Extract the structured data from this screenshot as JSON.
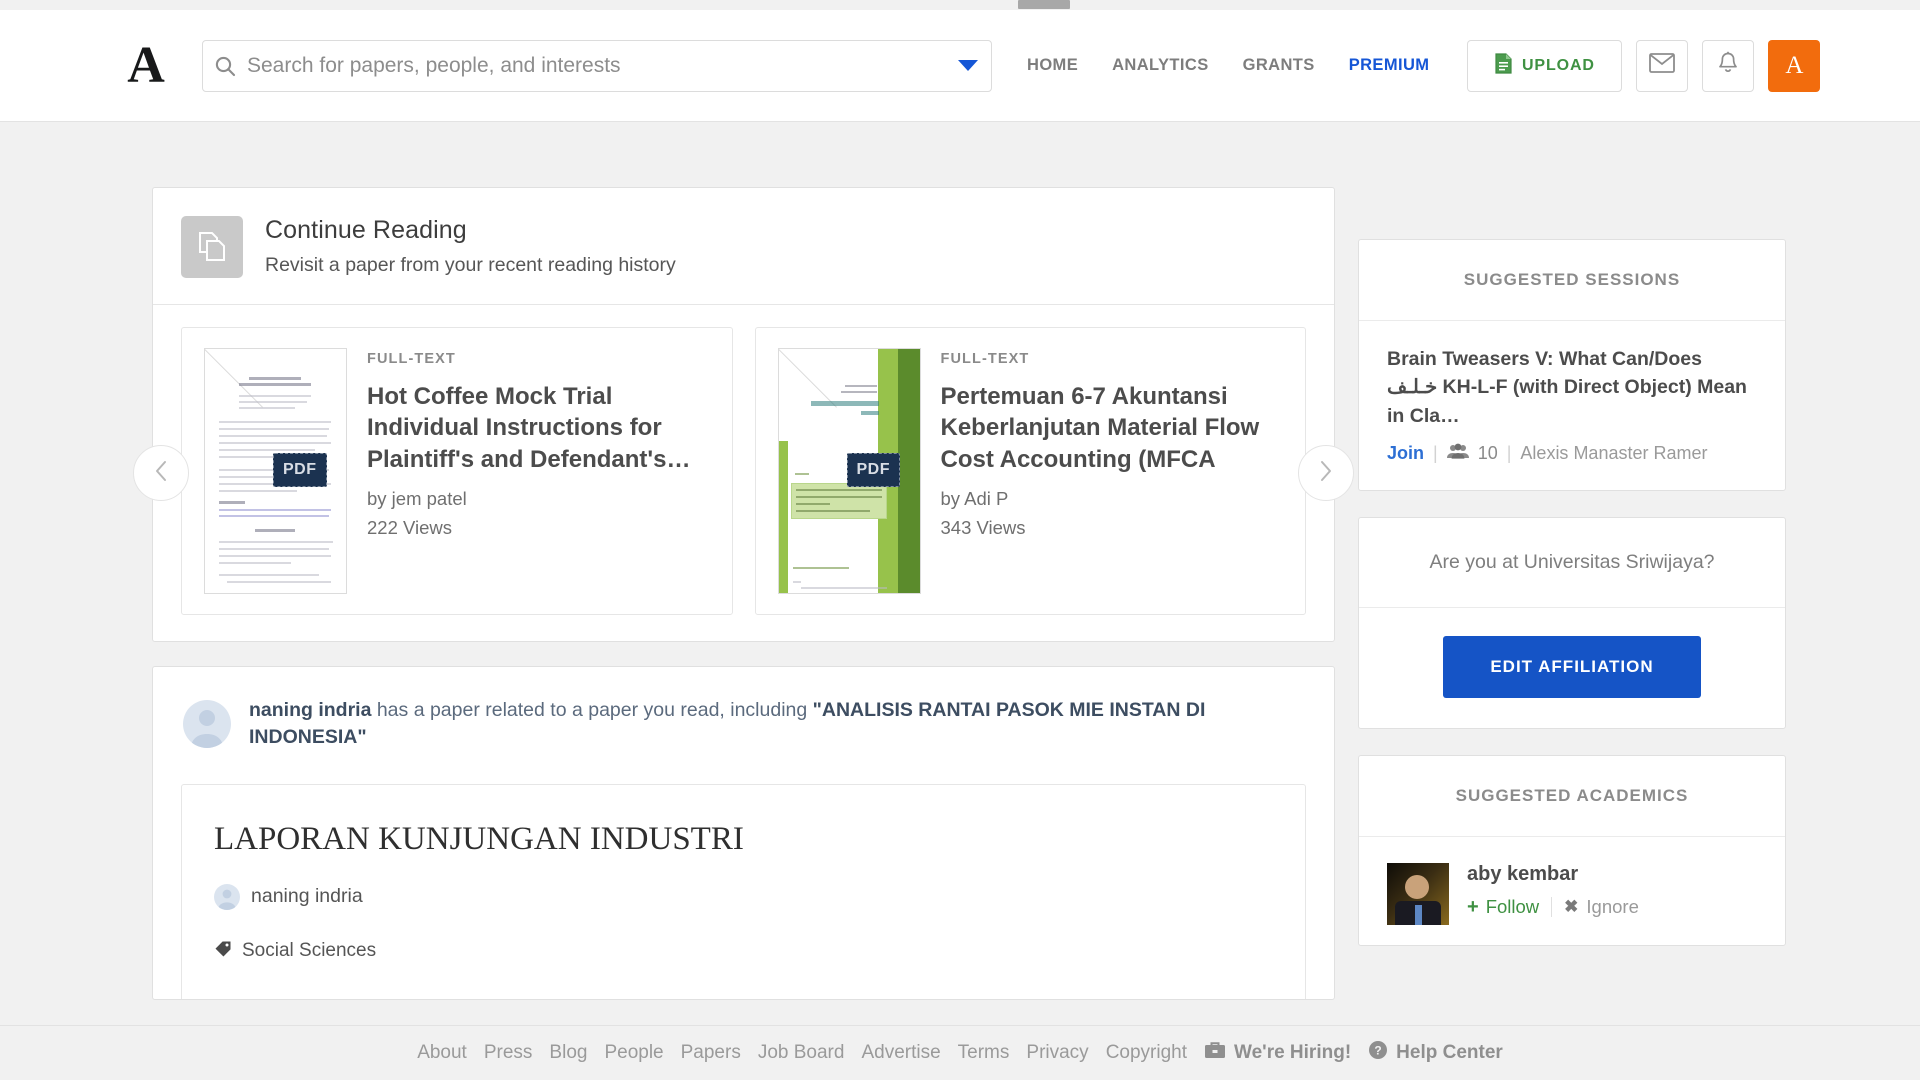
{
  "header": {
    "logo": "A",
    "logo_icon": "academia-logo-icon",
    "search": {
      "placeholder": "Search for papers, people, and interests",
      "value": "",
      "icon": "search-icon",
      "caret_icon": "chevron-down-icon"
    },
    "nav": [
      {
        "label": "HOME",
        "id": "home",
        "premium": false
      },
      {
        "label": "ANALYTICS",
        "id": "analytics",
        "premium": false
      },
      {
        "label": "GRANTS",
        "id": "grants",
        "premium": false
      },
      {
        "label": "PREMIUM",
        "id": "premium",
        "premium": true
      }
    ],
    "upload": {
      "label": "UPLOAD",
      "icon": "document-upload-icon"
    },
    "messages_icon": "envelope-icon",
    "notifications_icon": "bell-icon",
    "avatar_initial": "A",
    "avatar_color": "#f26c0d"
  },
  "continue_reading": {
    "icon": "copy-papers-icon",
    "title": "Continue Reading",
    "subtitle": "Revisit a paper from your recent reading history",
    "prev_icon": "chevron-left-icon",
    "next_icon": "chevron-right-icon",
    "papers": [
      {
        "tag": "FULL-TEXT",
        "title": "Hot Coffee Mock Trial Individual Instructions for Plaintiff's and Defendant's…",
        "author": "by jem patel",
        "views": "222 Views",
        "badge": "PDF"
      },
      {
        "tag": "FULL-TEXT",
        "title": "Pertemuan 6-7 Akuntansi Keberlanjutan Material Flow Cost Accounting (MFCA",
        "author": "by Adi P",
        "views": "343 Views",
        "badge": "PDF"
      }
    ]
  },
  "feed": {
    "actor": "naning indria",
    "message": " has a paper related to a paper you read, including ",
    "paper_quoted": "\"ANALISIS RANTAI PASOK MIE INSTAN DI INDONESIA\"",
    "paper": {
      "title": "LAPORAN KUNJUNGAN INDUSTRI",
      "author": "naning indria",
      "tag": "Social Sciences",
      "tag_icon": "tag-icon"
    }
  },
  "sidebar": {
    "sessions": {
      "heading": "SUGGESTED SESSIONS",
      "items": [
        {
          "title": "Brain Tweasers V: What Can/Does خـلـف KH-L-F (with Direct Object) Mean in Cla…",
          "join_label": "Join",
          "members_icon": "people-group-icon",
          "members_count": "10",
          "host": "Alexis Manaster Ramer"
        }
      ]
    },
    "affiliation": {
      "question": "Are you at Universitas Sriwijaya?",
      "button_label": "EDIT AFFILIATION",
      "button_color": "#1554c6"
    },
    "academics": {
      "heading": "SUGGESTED ACADEMICS",
      "items": [
        {
          "name": "aby kembar",
          "follow_label": "Follow",
          "follow_icon": "plus-icon",
          "ignore_label": "Ignore",
          "ignore_icon": "x-icon"
        }
      ]
    }
  },
  "footer": {
    "links": [
      {
        "label": "About",
        "icon": ""
      },
      {
        "label": "Press",
        "icon": ""
      },
      {
        "label": "Blog",
        "icon": ""
      },
      {
        "label": "People",
        "icon": ""
      },
      {
        "label": "Papers",
        "icon": ""
      },
      {
        "label": "Job Board",
        "icon": ""
      },
      {
        "label": "Advertise",
        "icon": ""
      },
      {
        "label": "Terms",
        "icon": ""
      },
      {
        "label": "Privacy",
        "icon": ""
      },
      {
        "label": "Copyright",
        "icon": ""
      },
      {
        "label": "We're Hiring!",
        "icon": "briefcase-icon"
      },
      {
        "label": "Help Center",
        "icon": "question-circle-icon"
      }
    ]
  }
}
